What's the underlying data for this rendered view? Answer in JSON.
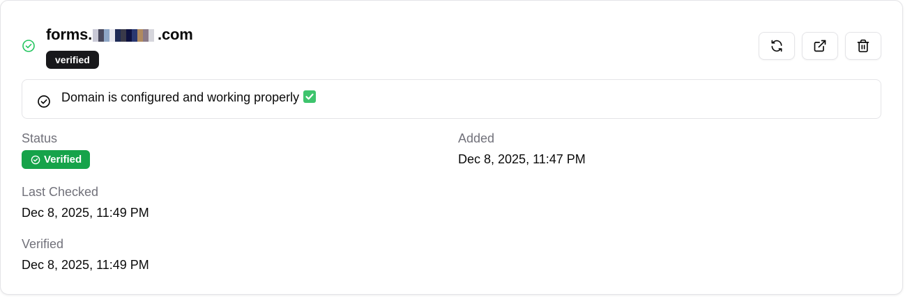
{
  "domain": {
    "prefix": "forms.",
    "suffix": ".com",
    "tag": "verified",
    "status_color": "#22c55e"
  },
  "actions": {
    "refresh_icon": "refresh-icon",
    "open_icon": "external-link-icon",
    "delete_icon": "trash-icon"
  },
  "alert": {
    "text": "Domain is configured and working properly",
    "emoji": "check-mark-button"
  },
  "details": {
    "status_label": "Status",
    "status_value": "Verified",
    "status_color": "#16a34a",
    "added_label": "Added",
    "added_value": "Dec 8, 2025, 11:47 PM",
    "last_checked_label": "Last Checked",
    "last_checked_value": "Dec 8, 2025, 11:49 PM",
    "verified_label": "Verified",
    "verified_value": "Dec 8, 2025, 11:49 PM"
  }
}
